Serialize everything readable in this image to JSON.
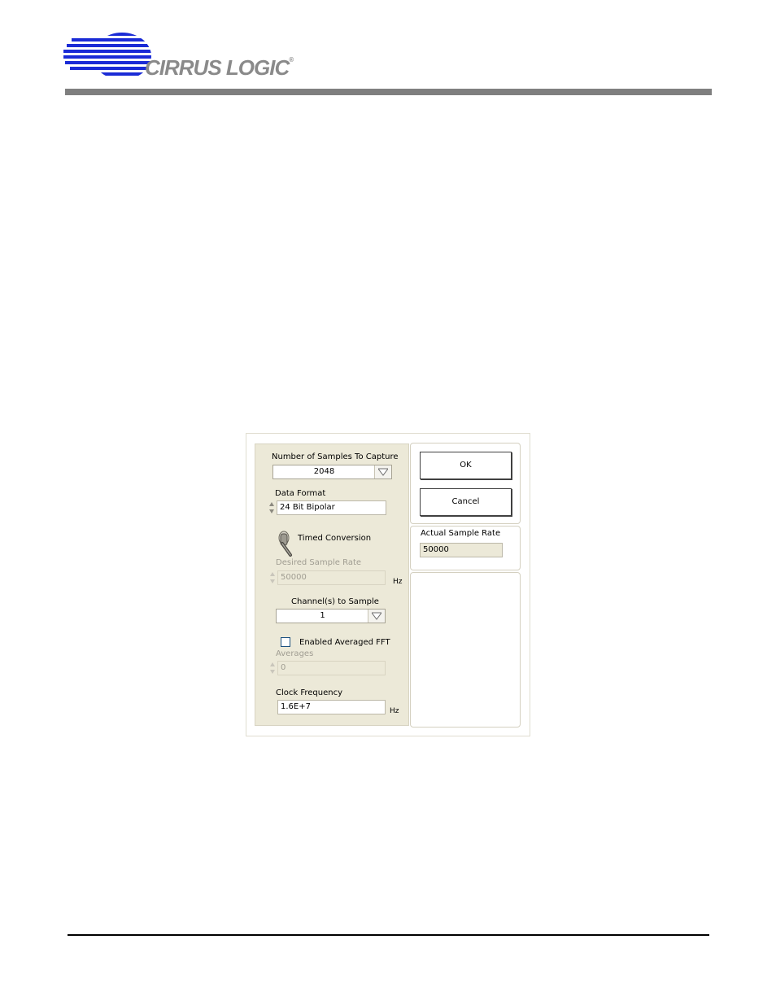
{
  "header": {
    "brand_text": "CIRRUS LOGIC",
    "brand_registered": "®",
    "logo_color": "#1a2bd6",
    "bar_color": "#7f7f7f"
  },
  "dialog": {
    "samples": {
      "label": "Number of Samples To Capture",
      "value": "2048"
    },
    "data_format": {
      "label": "Data Format",
      "value": "24 Bit  Bipolar"
    },
    "timed_conversion": {
      "label": "Timed Conversion"
    },
    "desired_rate": {
      "label": "Desired Sample Rate",
      "value": "50000",
      "unit": "Hz"
    },
    "channels": {
      "label": "Channel(s) to Sample",
      "value": "1"
    },
    "averaged_fft": {
      "label": "Enabled Averaged FFT",
      "checked": false
    },
    "averages": {
      "label": "Averages",
      "value": "0"
    },
    "clock": {
      "label": "Clock Frequency",
      "value": "1.6E+7",
      "unit": "Hz"
    },
    "ok_label": "OK",
    "cancel_label": "Cancel",
    "actual_rate": {
      "label": "Actual Sample Rate",
      "value": "50000"
    }
  }
}
